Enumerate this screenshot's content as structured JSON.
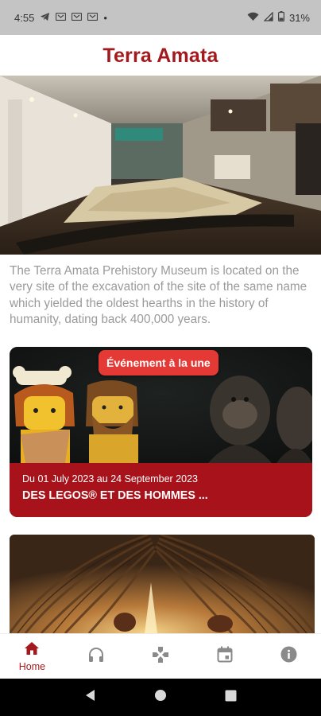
{
  "status_bar": {
    "time": "4:55",
    "notification_icons": [
      "telegram-icon",
      "voicemail-icon",
      "voicemail-icon",
      "voicemail-icon"
    ],
    "dot": "•",
    "battery": "31%"
  },
  "header": {
    "title": "Terra Amata"
  },
  "intro": {
    "text": "The Terra Amata Prehistory Museum is located on the very site of the excavation of the site of the same name which yielded the oldest hearths in the history of humanity, dating back 400,000 years."
  },
  "featured_event": {
    "badge": "Événement à la une",
    "dates": "Du 01 July 2023 au 24 September 2023",
    "title": "DES LEGOS® ET DES HOMMES ..."
  },
  "bottom_nav": {
    "items": [
      {
        "label": "Home",
        "icon": "home-icon",
        "active": true
      },
      {
        "label": "",
        "icon": "headphones-icon",
        "active": false
      },
      {
        "label": "",
        "icon": "gamepad-icon",
        "active": false
      },
      {
        "label": "",
        "icon": "calendar-icon",
        "active": false
      },
      {
        "label": "",
        "icon": "info-icon",
        "active": false
      }
    ]
  },
  "colors": {
    "brand": "#a31a1e",
    "badge": "#e53935",
    "inactive_icon": "#8a8a8a",
    "intro_text": "#9a9a9a"
  }
}
